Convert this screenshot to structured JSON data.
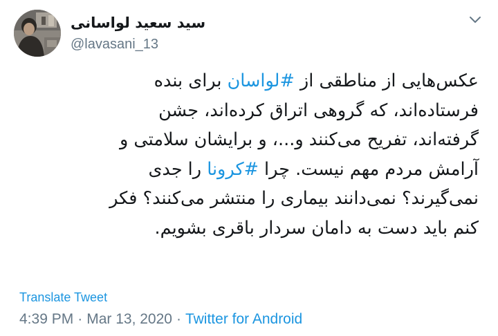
{
  "author": {
    "display_name": "سید سعید لواسانی",
    "handle": "@lavasani_13"
  },
  "tweet": {
    "lines": [
      [
        {
          "text": "عکس‌هایی از مناطقی از ",
          "hashtag": false
        },
        {
          "text": "#لواسان",
          "hashtag": true
        },
        {
          "text": " برای بنده",
          "hashtag": false
        }
      ],
      [
        {
          "text": "فرستاده‌اند، که گروهی اتراق کرده‌اند، جشن",
          "hashtag": false
        }
      ],
      [
        {
          "text": "گرفته‌اند، تفریح می‌کنند و...، و برایشان سلامتی و",
          "hashtag": false
        }
      ],
      [
        {
          "text": "آرامش مردم مهم نیست. چرا ",
          "hashtag": false
        },
        {
          "text": "#کرونا",
          "hashtag": true
        },
        {
          "text": " را جدی",
          "hashtag": false
        }
      ],
      [
        {
          "text": "نمی‌گیرند؟ نمی‌دانند بیماری را منتشر می‌کنند؟ فکر",
          "hashtag": false
        }
      ],
      [
        {
          "text": "کنم باید دست به دامان سردار باقری بشویم.",
          "hashtag": false
        }
      ]
    ]
  },
  "translate_label": "Translate Tweet",
  "meta": {
    "time": "4:39 PM",
    "separator": "·",
    "date": "Mar 13, 2020",
    "source": "Twitter for Android"
  },
  "icons": {
    "more": "chevron-down-icon",
    "avatar": "avatar"
  },
  "colors": {
    "link": "#1b95e0",
    "secondary_text": "#657786",
    "primary_text": "#14171a"
  }
}
